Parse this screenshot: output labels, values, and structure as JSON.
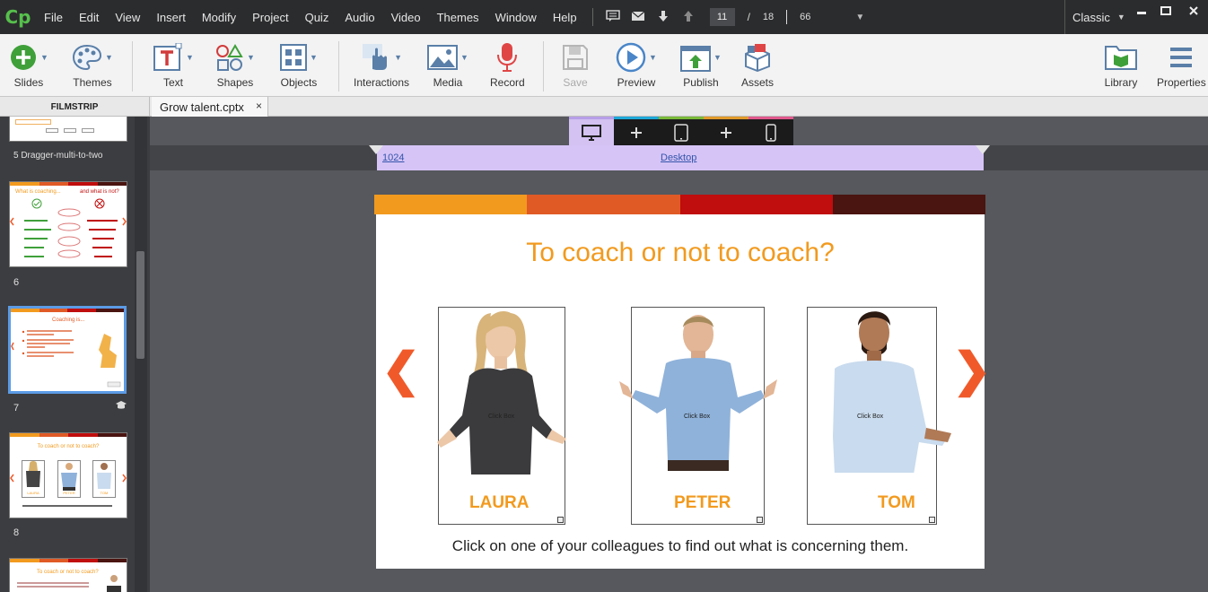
{
  "app": {
    "logo": "Cp"
  },
  "menu": [
    "File",
    "Edit",
    "View",
    "Insert",
    "Modify",
    "Project",
    "Quiz",
    "Audio",
    "Video",
    "Themes",
    "Window",
    "Help"
  ],
  "pager": {
    "current": "11",
    "separator": "/",
    "total": "18",
    "zoom": "66"
  },
  "workspace": {
    "label": "Classic"
  },
  "toolbar": {
    "slides": "Slides",
    "themes": "Themes",
    "text": "Text",
    "shapes": "Shapes",
    "objects": "Objects",
    "interactions": "Interactions",
    "media": "Media",
    "record": "Record",
    "save": "Save",
    "preview": "Preview",
    "publish": "Publish",
    "assets": "Assets",
    "library": "Library",
    "properties": "Properties"
  },
  "tabs": {
    "filmstrip": "FILMSTRIP",
    "document": "Grow talent.cptx",
    "close": "×"
  },
  "filmstrip": {
    "slide5_caption": "5 Dragger-multi-to-two",
    "slide6": {
      "num": "6",
      "title_left": "What is coaching...",
      "title_right": "and what is not?"
    },
    "slide7": {
      "num": "7",
      "title": "Coaching is..."
    },
    "slide8": {
      "num": "8",
      "title": "To coach or not to coach?",
      "names": [
        "LAURA",
        "PETER",
        "TOM"
      ]
    },
    "slide9": {
      "title": "To coach or not to coach?"
    }
  },
  "stage": {
    "breakpoint_width": "1024",
    "breakpoint_name": "Desktop",
    "colors": [
      "#f29a1e",
      "#e05a26",
      "#c00d0d",
      "#4a1410"
    ]
  },
  "slide": {
    "title": "To coach or not to coach?",
    "people": [
      {
        "name": "LAURA",
        "click_box": "Click Box"
      },
      {
        "name": "PETER",
        "click_box": "Click Box"
      },
      {
        "name": "TOM",
        "click_box": "Click Box"
      }
    ],
    "caption": "Click on one of your colleagues to find out what is concerning them.",
    "prev": "❮",
    "next": "❯"
  }
}
